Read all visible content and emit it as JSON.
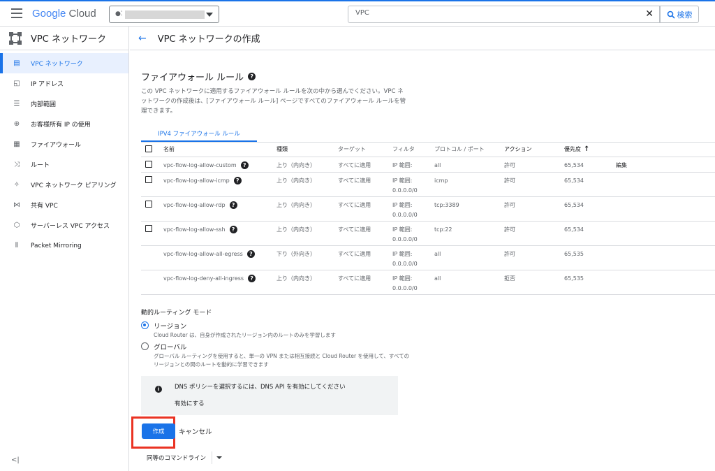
{
  "topbar": {
    "logo_google": "Google",
    "logo_cloud": "Cloud",
    "search_value": "VPC",
    "search_button": "検索"
  },
  "sidebar": {
    "title": "VPC ネットワーク",
    "items": [
      {
        "label": "VPC ネットワーク",
        "icon": "vpc-network-icon"
      },
      {
        "label": "IP アドレス",
        "icon": "ip-address-icon"
      },
      {
        "label": "内部範囲",
        "icon": "internal-ranges-icon"
      },
      {
        "label": "お客様所有 IP の使用",
        "icon": "byoip-icon"
      },
      {
        "label": "ファイアウォール",
        "icon": "firewall-icon"
      },
      {
        "label": "ルート",
        "icon": "routes-icon"
      },
      {
        "label": "VPC ネットワーク ピアリング",
        "icon": "peering-icon"
      },
      {
        "label": "共有 VPC",
        "icon": "shared-vpc-icon"
      },
      {
        "label": "サーバーレス VPC アクセス",
        "icon": "serverless-icon"
      },
      {
        "label": "Packet Mirroring",
        "icon": "packet-mirroring-icon"
      }
    ],
    "collapse_label": "<|"
  },
  "page": {
    "title": "VPC ネットワークの作成",
    "section_title": "ファイアウォール ルール",
    "section_desc": "この VPC ネットワークに適用するファイアウォール ルールを次の中から選んでください。VPC ネットワークの作成後は、[ファイアウォール ルール] ページですべてのファイアウォール ルールを管理できます。",
    "tab_label": "IPV4 ファイアウォール ルール"
  },
  "table": {
    "headers": [
      "名前",
      "種類",
      "ターゲット",
      "フィルタ",
      "プロトコル / ポート",
      "アクション",
      "優先度"
    ],
    "rows": [
      {
        "name": "vpc-flow-log-allow-custom",
        "type": "上り（内向き）",
        "target": "すべてに適用",
        "filter1": "IP 範囲:",
        "filter2": "",
        "protocol": "all",
        "action": "許可",
        "priority": "65,534",
        "edit": "編集",
        "checkbox": true
      },
      {
        "name": "vpc-flow-log-allow-icmp",
        "type": "上り（内向き）",
        "target": "すべてに適用",
        "filter1": "IP 範囲:",
        "filter2": "0.0.0.0/0",
        "protocol": "icmp",
        "action": "許可",
        "priority": "65,534",
        "edit": "",
        "checkbox": true
      },
      {
        "name": "vpc-flow-log-allow-rdp",
        "type": "上り（内向き）",
        "target": "すべてに適用",
        "filter1": "IP 範囲:",
        "filter2": "0.0.0.0/0",
        "protocol": "tcp:3389",
        "action": "許可",
        "priority": "65,534",
        "edit": "",
        "checkbox": true
      },
      {
        "name": "vpc-flow-log-allow-ssh",
        "type": "上り（内向き）",
        "target": "すべてに適用",
        "filter1": "IP 範囲:",
        "filter2": "0.0.0.0/0",
        "protocol": "tcp:22",
        "action": "許可",
        "priority": "65,534",
        "edit": "",
        "checkbox": true
      },
      {
        "name": "vpc-flow-log-allow-all-egress",
        "type": "下り（外向き）",
        "target": "すべてに適用",
        "filter1": "IP 範囲:",
        "filter2": "0.0.0.0/0",
        "protocol": "all",
        "action": "許可",
        "priority": "65,535",
        "edit": "",
        "checkbox": false
      },
      {
        "name": "vpc-flow-log-deny-all-ingress",
        "type": "上り（内向き）",
        "target": "すべてに適用",
        "filter1": "IP 範囲:",
        "filter2": "0.0.0.0/0",
        "protocol": "all",
        "action": "拒否",
        "priority": "65,535",
        "edit": "",
        "checkbox": false
      }
    ]
  },
  "routing": {
    "title": "動的ルーティング モード",
    "options": [
      {
        "label": "リージョン",
        "desc": "Cloud Router は、自身が作成されたリージョン内のルートのみを学習します",
        "checked": true
      },
      {
        "label": "グローバル",
        "desc": "グローバル ルーティングを使用すると、単一の VPN または相互接続と Cloud Router を使用して、すべてのリージョンとの間のルートを動的に学習できます",
        "checked": false
      }
    ]
  },
  "info": {
    "text": "DNS ポリシーを選択するには、DNS API を有効にしてください",
    "link": "有効にする"
  },
  "actions": {
    "create": "作成",
    "cancel": "キャンセル",
    "command_line": "同等のコマンドライン"
  },
  "colors": {
    "accent": "#1a73e8",
    "highlight": "#ea3323"
  }
}
